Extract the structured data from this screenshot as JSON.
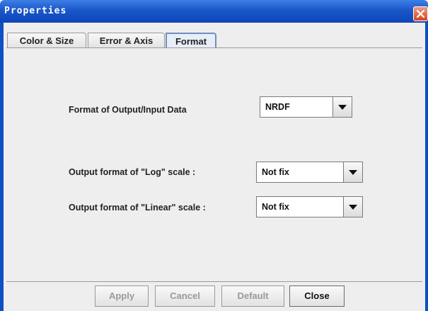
{
  "window": {
    "title": "Properties"
  },
  "tabs": [
    {
      "label": "Color & Size",
      "selected": false
    },
    {
      "label": "Error & Axis",
      "selected": false
    },
    {
      "label": "Format",
      "selected": true
    }
  ],
  "format_panel": {
    "io_format_label": "Format of Output/Input Data",
    "io_format_value": "NRDF",
    "log_label": "Output format of \"Log\" scale :",
    "log_value": "Not fix",
    "linear_label": "Output format of \"Linear\" scale :",
    "linear_value": "Not fix"
  },
  "buttons": {
    "apply": "Apply",
    "cancel": "Cancel",
    "default": "Default",
    "close": "Close"
  },
  "colors": {
    "titlebar": "#1a57c9",
    "close_button": "#d8441f",
    "panel_bg": "#eeeeee"
  }
}
